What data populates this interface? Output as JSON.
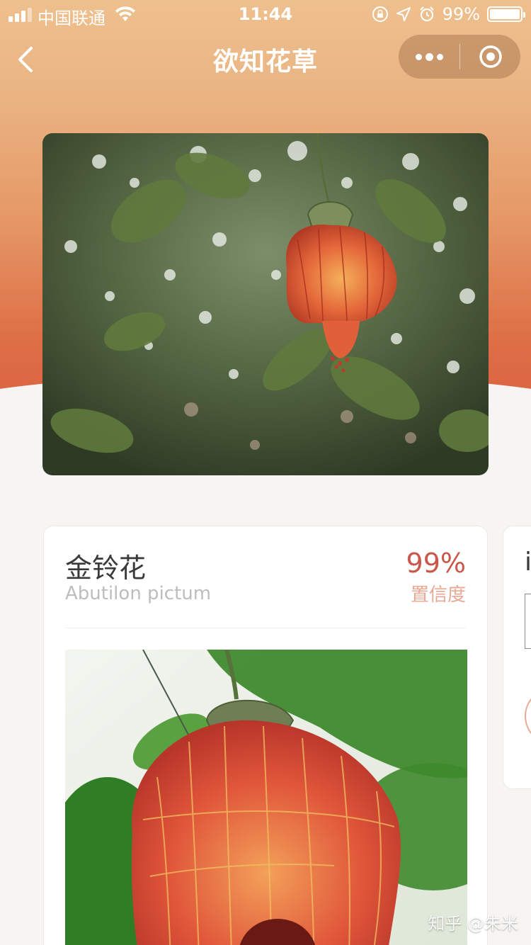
{
  "status_bar": {
    "carrier": "中国联通",
    "time": "11:44",
    "battery": "99%",
    "battery_level": 0.99,
    "icons": [
      "signal-icon",
      "wifi-icon",
      "orientation-lock-icon",
      "location-icon",
      "alarm-icon",
      "battery-icon"
    ]
  },
  "nav": {
    "title": "欲知花草",
    "back_icon": "chevron-left-icon",
    "more_icon": "more-dots-icon",
    "close_icon": "target-close-icon"
  },
  "result": {
    "name_cn": "金铃花",
    "name_latin": "Abutilon pictum",
    "confidence_value": "99%",
    "confidence_label": "置信度"
  },
  "next_card": {
    "partial_char": "i"
  },
  "watermark": "知乎 @朱米",
  "colors": {
    "header_top": "#eec08e",
    "header_bottom": "#db6542",
    "accent": "#c9574a",
    "accent_light": "#e8a894",
    "background": "#f7f5f3"
  }
}
